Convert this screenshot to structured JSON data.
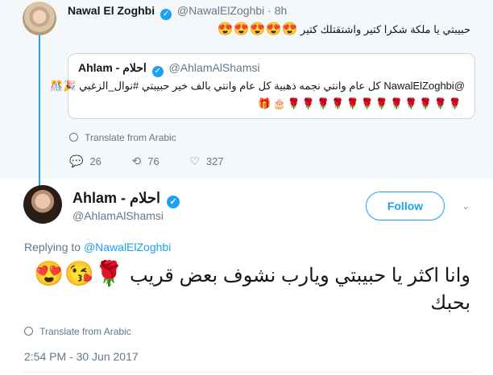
{
  "parent_tweet": {
    "author_name": "Nawal El Zoghbi",
    "author_handle": "@NawalElZoghbi",
    "separator": "·",
    "time_ago": "8h",
    "text": "حبيبتي يا ملكة شكرا كتير واشتقتلك كتير",
    "emojis": "😍😍😍😍😍",
    "quoted": {
      "author_name": "Ahlam - احلام",
      "author_handle": "@AhlamAlShamsi",
      "text": "@NawalElZoghbi كل عام وانتي نجمه ذهبية كل عام وانتي بالف خير حبيبتي #نوال_الزغبي",
      "emojis": "🎉🎊",
      "emoji_row": "🎁🎂🌹🌹🌹🌹🌹🌹🌹🌹🌹🌹🌹🌹"
    },
    "translate_label": "Translate from Arabic",
    "actions": {
      "reply_count": "26",
      "retweet_count": "76",
      "like_count": "327"
    }
  },
  "main_tweet": {
    "author_name": "Ahlam - احلام",
    "author_handle": "@AhlamAlShamsi",
    "follow_label": "Follow",
    "replying_prefix": "Replying to",
    "replying_handle": "@NawalElZoghbi",
    "text": "وانا اكثر يا حبيبتي ويارب نشوف بعض قريب",
    "emojis": "🌹😘😍",
    "text_line2": "بحبك",
    "translate_label": "Translate from Arabic",
    "timestamp": "2:54 PM - 30 Jun 2017"
  },
  "colors": {
    "accent": "#1da1f2",
    "muted": "#657786",
    "parent_bg": "#f5f8fa"
  }
}
